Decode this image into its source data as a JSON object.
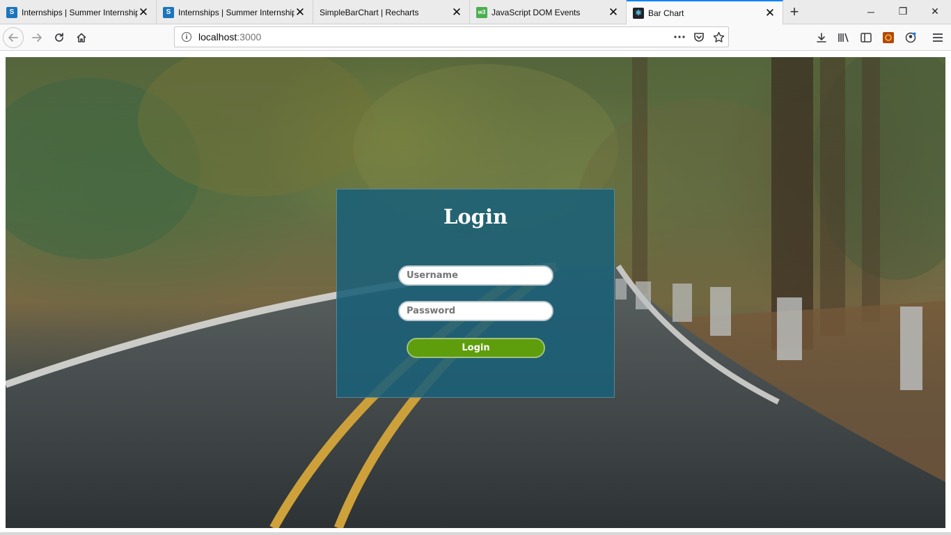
{
  "browser": {
    "tabs": [
      {
        "title": "Internships | Summer Internships",
        "favicon": "S",
        "active": false
      },
      {
        "title": "Internships | Summer Internships",
        "favicon": "S",
        "active": false
      },
      {
        "title": "SimpleBarChart | Recharts",
        "favicon": "",
        "active": false
      },
      {
        "title": "JavaScript DOM Events",
        "favicon": "w3",
        "active": false
      },
      {
        "title": "Bar Chart",
        "favicon": "⚛",
        "active": true
      }
    ],
    "close_glyph": "✕",
    "new_tab_glyph": "+",
    "window_controls": {
      "minimize": "─",
      "restore": "❐",
      "close": "✕"
    },
    "url": {
      "host": "localhost",
      "port": ":3000"
    },
    "icons": {
      "back": "back-arrow-icon",
      "forward": "forward-arrow-icon",
      "reload": "reload-icon",
      "home": "home-icon",
      "page_actions": "more-dots-icon",
      "pocket": "pocket-icon",
      "bookmark": "star-icon",
      "download": "download-icon",
      "library": "library-icon",
      "sidebar": "sidebar-icon",
      "extension": "extension-icon",
      "account": "account-icon",
      "menu": "hamburger-menu-icon"
    },
    "accent_color": "#0a84ff"
  },
  "login": {
    "title": "Login",
    "username_placeholder": "Username",
    "password_placeholder": "Password",
    "button_label": "Login",
    "panel_color": "#1a6078",
    "button_color": "#5e9e0c"
  }
}
